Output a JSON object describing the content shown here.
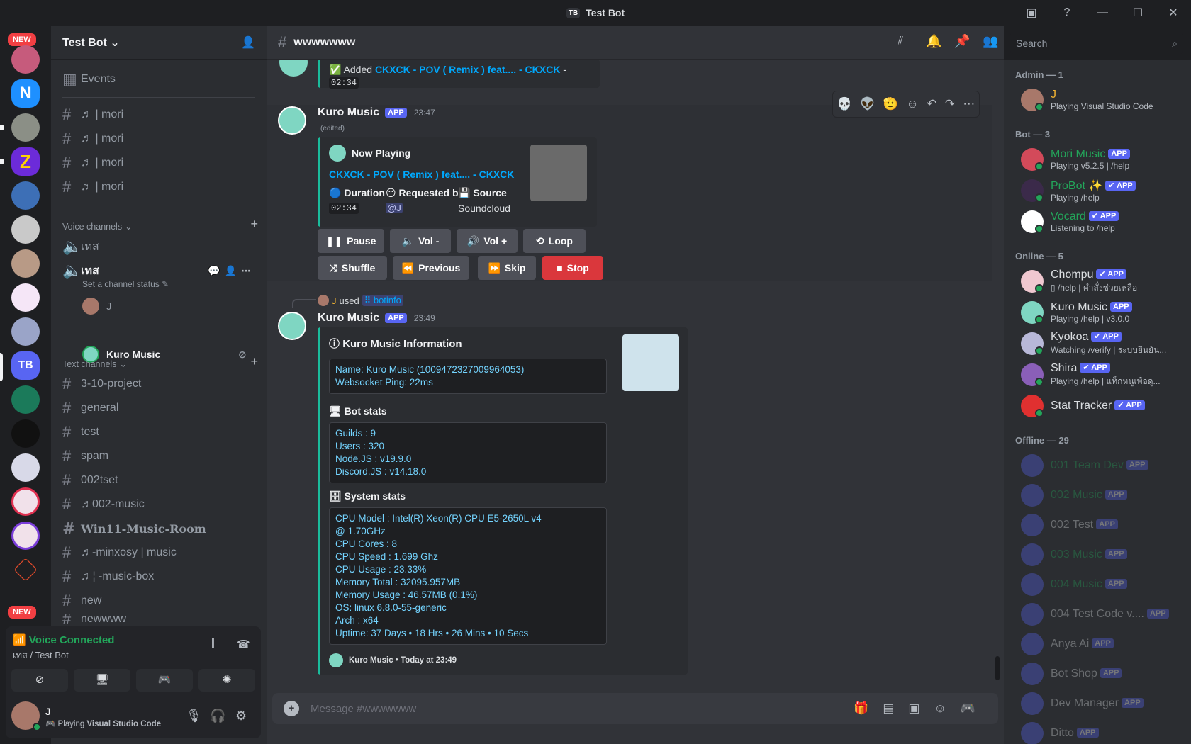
{
  "window": {
    "title": "Test Bot",
    "icon_text": "TB"
  },
  "servers": {
    "new_badge": "NEW",
    "tb_label": "TB"
  },
  "sidebar": {
    "server_name": "Test Bot",
    "events": "Events",
    "top_channels": [
      "♬ | mori",
      "♬ | mori",
      "♬ | mori",
      "♬ | mori"
    ],
    "voice_category": "Voice channels",
    "voice_channels": [
      {
        "name": "เทส"
      },
      {
        "name": "เทส",
        "status": "Set a channel status",
        "users": [
          "J",
          "Kuro Music"
        ]
      }
    ],
    "text_category": "Text channels",
    "text_channels": [
      "3-10-project",
      "general",
      "test",
      "spam",
      "002tset",
      "♬002-music",
      "Win11-Music-Room",
      "♬-minxosy | music",
      "♫ ¦ -music-box",
      "new",
      "newwww"
    ]
  },
  "voice_panel": {
    "status": "Voice Connected",
    "location": "เทส / Test Bot",
    "user": "J",
    "activity_prefix": "Playing ",
    "activity": "Visual Studio Code"
  },
  "header": {
    "channel": "wwwwwww",
    "search_placeholder": "Search"
  },
  "chat": {
    "added_prefix": "Added ",
    "added_track": "CKXCK - POV ( Remix ) feat.... - CKXCK",
    "added_sep": " - ",
    "added_time": "02:34",
    "msg1": {
      "author": "Kuro Music",
      "badge": "APP",
      "time": "23:47",
      "edited": "(edited)",
      "embed_title": "Now Playing",
      "track": "CKXCK - POV ( Remix ) feat.... - CKXCK",
      "duration_label": "Duration",
      "duration": "02:34",
      "requested_label": "Requested by",
      "requested": "@J",
      "source_label": "Source",
      "source": "Soundcloud",
      "buttons": [
        "Pause",
        "Vol -",
        "Vol +",
        "Loop",
        "Shuffle",
        "Previous",
        "Skip",
        "Stop"
      ]
    },
    "reply": {
      "user": "J",
      "used": "used",
      "command": "botinfo"
    },
    "msg2": {
      "author": "Kuro Music",
      "badge": "APP",
      "time": "23:49",
      "embed_title": "Kuro Music Information",
      "info_lines": [
        "Name: Kuro Music (1009472327009964053)",
        "Websocket Ping: 22ms"
      ],
      "bot_stats_title": "Bot stats",
      "bot_stats": [
        "Guilds : 9",
        "Users : 320",
        "Node.JS : v19.9.0",
        "Discord.JS : v14.18.0"
      ],
      "system_stats_title": "System stats",
      "system_stats": [
        "CPU Model : Intel(R) Xeon(R) CPU E5-2650L v4",
        "@ 1.70GHz",
        "CPU Cores : 8",
        "CPU Speed : 1.699 Ghz",
        "CPU Usage : 23.33%",
        "Memory Total : 32095.957MB",
        "Memory Usage : 46.57MB (0.1%)",
        "OS: linux 6.8.0-55-generic",
        "Arch : x64",
        "Uptime: 37 Days • 18 Hrs • 26 Mins • 10 Secs"
      ],
      "footer": "Kuro Music • Today at 23:49"
    },
    "composer_placeholder": "Message #wwwwwww"
  },
  "members": {
    "groups": [
      {
        "title": "Admin — 1",
        "items": [
          {
            "name": "J",
            "status": "Playing Visual Studio Code",
            "color": "#f0b232"
          }
        ]
      },
      {
        "title": "Bot — 3",
        "items": [
          {
            "name": "Mori Music",
            "status": "Playing v5.2.5 | /help",
            "color": "#23a55a",
            "badge": "APP"
          },
          {
            "name": "ProBot ✨",
            "status": "Playing /help",
            "color": "#23a55a",
            "badge": "✔ APP"
          },
          {
            "name": "Vocard",
            "status": "Listening to /help",
            "color": "#23a55a",
            "badge": "✔ APP"
          }
        ]
      },
      {
        "title": "Online — 5",
        "items": [
          {
            "name": "Chompu",
            "status": "▯ /help | คำสั่งช่วยเหลือ",
            "color": "#dbdee1",
            "badge": "✔ APP"
          },
          {
            "name": "Kuro Music",
            "status": "Playing /help | v3.0.0",
            "color": "#dbdee1",
            "badge": "APP"
          },
          {
            "name": "Kyokoa",
            "status": "Watching /verify | ระบบยืนยัน...",
            "color": "#dbdee1",
            "badge": "✔ APP"
          },
          {
            "name": "Shira",
            "status": "Playing /help | แท็กหนูเพื่อดู...",
            "color": "#dbdee1",
            "badge": "✔ APP"
          },
          {
            "name": "Stat Tracker",
            "status": "",
            "color": "#dbdee1",
            "badge": "✔ APP"
          }
        ]
      },
      {
        "title": "Offline — 29",
        "items": [
          {
            "name": "001 Team Dev",
            "badge": "APP",
            "color": "#23a55a"
          },
          {
            "name": "002 Music",
            "badge": "APP",
            "color": "#23a55a"
          },
          {
            "name": "002 Test",
            "badge": "APP",
            "color": "#dbdee1"
          },
          {
            "name": "003 Music",
            "badge": "APP",
            "color": "#23a55a"
          },
          {
            "name": "004 Music",
            "badge": "APP",
            "color": "#23a55a"
          },
          {
            "name": "004 Test Code v....",
            "badge": "APP",
            "color": "#dbdee1"
          },
          {
            "name": "Anya Ai",
            "badge": "APP",
            "color": "#dbdee1"
          },
          {
            "name": "Bot Shop",
            "badge": "APP",
            "color": "#dbdee1"
          },
          {
            "name": "Dev Manager",
            "badge": "APP",
            "color": "#dbdee1"
          },
          {
            "name": "Ditto",
            "badge": "APP",
            "color": "#dbdee1"
          }
        ]
      }
    ]
  }
}
